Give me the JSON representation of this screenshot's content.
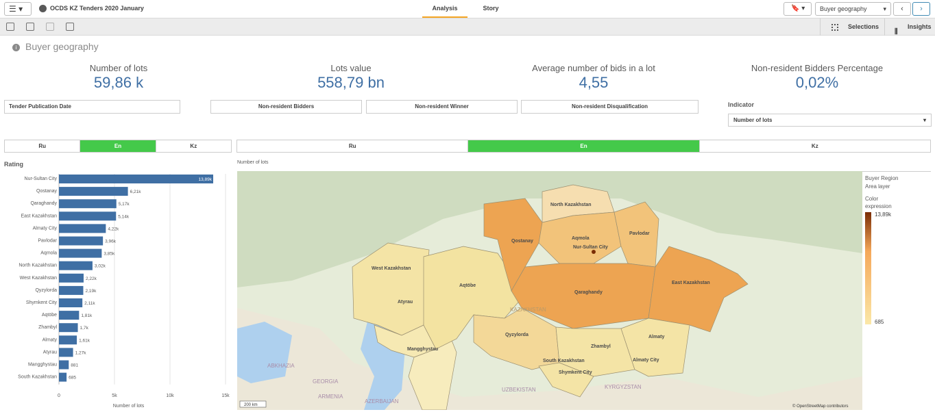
{
  "app": {
    "menu_label": "☰ ▾",
    "title": "OCDS KZ Tenders 2020 January"
  },
  "tabs": [
    {
      "label": "Analysis",
      "active": true
    },
    {
      "label": "Story",
      "active": false
    }
  ],
  "header_right": {
    "bookmark_label": "🔖 ▾",
    "sheet_name": "Buyer geography",
    "sheet_caret": "▾",
    "prev": "‹",
    "next": "›"
  },
  "toolbar": {
    "selections": "Selections",
    "insights": "Insights"
  },
  "sheet": {
    "info_glyph": "i",
    "title": "Buyer geography"
  },
  "kpis": [
    {
      "label": "Number of lots",
      "value": "59,86 k"
    },
    {
      "label": "Lots value",
      "value": "558,79 bn"
    },
    {
      "label": "Average number of bids in a lot",
      "value": "4,55"
    },
    {
      "label": "Non-resident Bidders Percentage",
      "value": "0,02%"
    }
  ],
  "filters": {
    "date": "Tender Publication Date",
    "bidders": "Non-resident Bidders",
    "winner": "Non-resident Winner",
    "disq": "Non-resident Disqualification"
  },
  "indicator": {
    "label": "Indicator",
    "value": "Number of lots",
    "caret": "▾"
  },
  "lang_left": [
    {
      "label": "Ru",
      "on": false
    },
    {
      "label": "En",
      "on": true
    },
    {
      "label": "Kz",
      "on": false
    }
  ],
  "lang_map": [
    {
      "label": "Ru",
      "on": false
    },
    {
      "label": "En",
      "on": true
    },
    {
      "label": "Kz",
      "on": false
    }
  ],
  "rating_title": "Rating",
  "chart_data": {
    "type": "bar",
    "orientation": "horizontal",
    "categories": [
      "Nur-Sultan City",
      "Qostanay",
      "Qaraghandy",
      "East Kazakhstan",
      "Almaty City",
      "Pavlodar",
      "Aqmola",
      "North Kazakhstan",
      "West Kazakhstan",
      "Qyzylorda",
      "Shymkent City",
      "Aqtöbe",
      "Zhambyl",
      "Almaty",
      "Atyrau",
      "Mangghystau",
      "South Kazakhstan"
    ],
    "values": [
      13890,
      6210,
      5170,
      5140,
      4220,
      3960,
      3850,
      3020,
      2220,
      2190,
      2110,
      1810,
      1700,
      1610,
      1270,
      881,
      685
    ],
    "labels": [
      "13,89k",
      "6,21k",
      "5,17k",
      "5,14k",
      "4,22k",
      "3,96k",
      "3,85k",
      "3,02k",
      "2,22k",
      "2,19k",
      "2,11k",
      "1,81k",
      "1,7k",
      "1,61k",
      "1,27k",
      "881",
      "685"
    ],
    "xticks": [
      "0",
      "5k",
      "10k",
      "15k"
    ],
    "xlim": [
      0,
      15000
    ],
    "xlabel": "Number of lots",
    "color": "#3f6fa4"
  },
  "map": {
    "title": "Number of lots",
    "legend_title1": "Buyer Region",
    "legend_title2": "Area layer",
    "legend_title3": "Color expression",
    "legend_max": "13,89k",
    "legend_min": "685",
    "scale": "200 km",
    "attribution": "© OpenStreetMap contributors",
    "region_labels": [
      "North Kazakhstan",
      "Qostanay",
      "Aqmola",
      "Nur-Sultan City",
      "Pavlodar",
      "West Kazakhstan",
      "Aqtöbe",
      "Atyrau",
      "Qaraghandy",
      "East Kazakhstan",
      "Qyzylorda",
      "Mangghystau",
      "Zhambyl",
      "Almaty",
      "South Kazakhstan",
      "Almaty City",
      "Shymkent City"
    ],
    "country_labels": [
      "KAZAKHSTAN",
      "ABKHAZIA",
      "GEORGIA",
      "ARMENIA",
      "AZERBAIJAN",
      "UZBEKISTAN",
      "KYRGYZSTAN"
    ]
  }
}
